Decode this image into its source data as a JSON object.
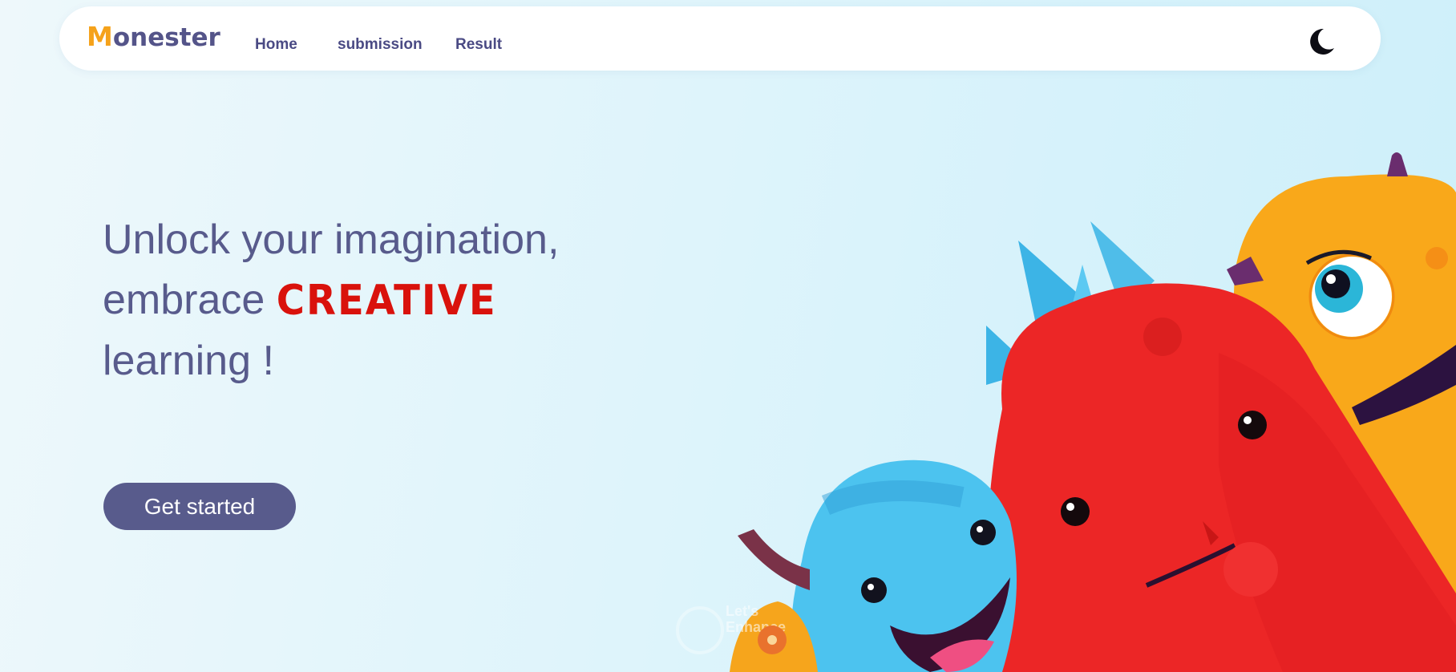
{
  "header": {
    "logo_first_letter": "M",
    "logo_rest": "onester",
    "nav": [
      {
        "label": "Home"
      },
      {
        "label": "submission"
      },
      {
        "label": "Result"
      }
    ],
    "theme_toggle_icon": "moon-icon"
  },
  "hero": {
    "line1": "Unlock your imagination,",
    "line2_prefix": "embrace",
    "line2_accent": "CREATIVE",
    "line3": "learning !",
    "cta_label": "Get started"
  },
  "watermark": {
    "text": "Let's Enhance"
  },
  "colors": {
    "brand_primary": "#585b8c",
    "logo_accent": "#f5a21b",
    "accent_red": "#d9120c",
    "background": "#dff4fb"
  }
}
